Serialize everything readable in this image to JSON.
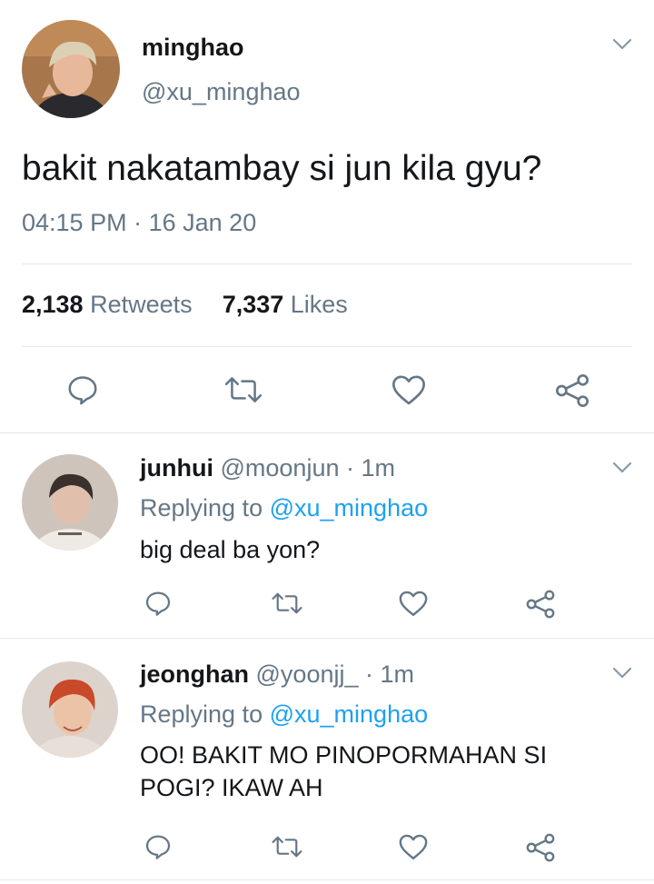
{
  "main_tweet": {
    "display_name": "minghao",
    "handle": "@xu_minghao",
    "text": "bakit nakatambay si jun kila gyu?",
    "time": "04:15 PM",
    "date_separator": "·",
    "date": "16 Jan 20",
    "retweets_count": "2,138",
    "retweets_label": "Retweets",
    "likes_count": "7,337",
    "likes_label": "Likes",
    "avatar_colors": {
      "bg": "#b07a4a",
      "hair": "#d9cdb0",
      "skin": "#e8b89a"
    }
  },
  "replies": [
    {
      "display_name": "junhui",
      "handle": "@moonjun",
      "separator": "·",
      "time": "1m",
      "replying_prefix": "Replying to",
      "replying_to": "@xu_minghao",
      "text": "big deal ba yon?",
      "avatar_colors": {
        "bg": "#c9bdb4",
        "hair": "#3a302c",
        "skin": "#e0c0ad"
      }
    },
    {
      "display_name": "jeonghan",
      "handle": "@yoonjj_",
      "separator": "·",
      "time": "1m",
      "replying_prefix": "Replying to",
      "replying_to": "@xu_minghao",
      "text_line1": "OO! BAKIT MO PINOPORMAHAN SI",
      "text_line2": "POGI? IKAW AH",
      "avatar_colors": {
        "bg": "#d8cfc8",
        "hair": "#c84a2a",
        "skin": "#edc3a8"
      }
    }
  ],
  "icons": [
    "reply-icon",
    "retweet-icon",
    "like-icon",
    "share-icon",
    "chevron-down-icon"
  ],
  "colors": {
    "link": "#1da1f2",
    "muted": "#657786",
    "divider": "#e1e8ed",
    "text": "#14171a"
  }
}
